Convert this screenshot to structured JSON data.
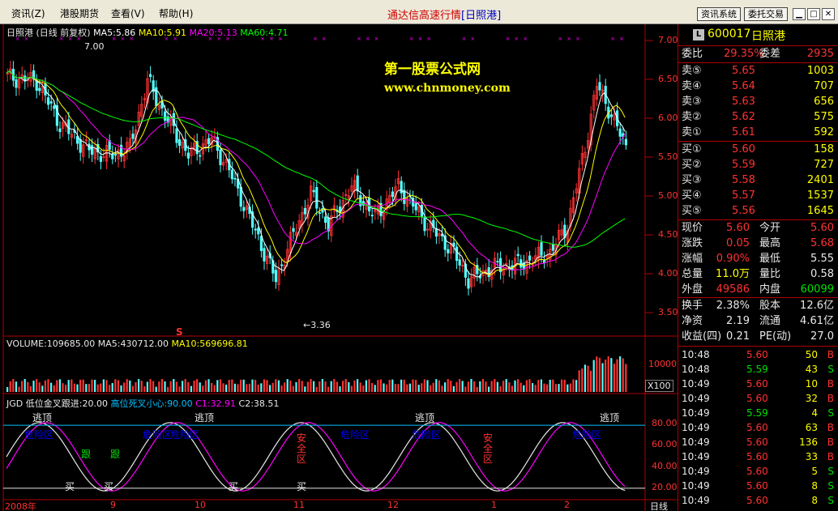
{
  "menu": {
    "items": [
      "资讯(Z)",
      "港股期货",
      "查看(V)",
      "帮助(H)"
    ],
    "title": "通达信高速行情",
    "title_stock": "[日照港]",
    "btn_info": "资讯系统",
    "btn_trade": "委托交易"
  },
  "chart": {
    "header_name": "日照港",
    "header_period": "(日线 前复权)",
    "ma": [
      {
        "label": "MA5:5.86",
        "color": "#ffffff"
      },
      {
        "label": "MA10:5.91",
        "color": "#ffff00"
      },
      {
        "label": "MA20:5.13",
        "color": "#ff00ff"
      },
      {
        "label": "MA60:4.71",
        "color": "#00ff00"
      }
    ],
    "watermark_1": "第一股票公式网",
    "watermark_2": "www.chnmoney.com",
    "high_label": "7.00",
    "low_label": "3.36",
    "s_marker": "S",
    "price_axis": [
      "7.00",
      "6.50",
      "6.00",
      "5.50",
      "5.00",
      "4.50",
      "4.00",
      "3.50"
    ],
    "volume_header": "VOLUME:109685.00",
    "volume_ma5": "MA5:430712.00",
    "volume_ma10": "MA10:569696.81",
    "volume_axis": [
      "10000"
    ],
    "volume_unit": "X100",
    "indicator_header": "JGD",
    "indicator_params": [
      {
        "label": "低位金叉跟进:20.00",
        "color": "#e8e8e8"
      },
      {
        "label": "高位死叉小心:90.00",
        "color": "#00c0ff"
      },
      {
        "label": "C1:32.91",
        "color": "#ff00ff"
      },
      {
        "label": "C2:38.51",
        "color": "#e8e8e8"
      }
    ],
    "indicator_axis": [
      "80.00",
      "60.00",
      "40.00",
      "20.00"
    ],
    "signal_escape": "逃顶",
    "signal_danger": "危险区",
    "signal_buy": "买",
    "signal_safe": "安全区",
    "signal_follow": "跟",
    "date_axis": [
      "2008年",
      "9",
      "10",
      "11",
      "12",
      "1",
      "2"
    ],
    "period_label": "日线",
    "price_scale": [
      3.36,
      7.0
    ]
  },
  "quote": {
    "code": "600017",
    "name": "日照港",
    "badge": "L",
    "ratio": {
      "label1": "委比",
      "value1": "29.35%",
      "label2": "委差",
      "value2": "2935"
    },
    "asks": [
      {
        "label": "卖⑤",
        "price": "5.65",
        "vol": "1003"
      },
      {
        "label": "卖④",
        "price": "5.64",
        "vol": "707"
      },
      {
        "label": "卖③",
        "price": "5.63",
        "vol": "656"
      },
      {
        "label": "卖②",
        "price": "5.62",
        "vol": "575"
      },
      {
        "label": "卖①",
        "price": "5.61",
        "vol": "592"
      }
    ],
    "bids": [
      {
        "label": "买①",
        "price": "5.60",
        "vol": "158"
      },
      {
        "label": "买②",
        "price": "5.59",
        "vol": "727"
      },
      {
        "label": "买③",
        "price": "5.58",
        "vol": "2401"
      },
      {
        "label": "买④",
        "price": "5.57",
        "vol": "1537"
      },
      {
        "label": "买⑤",
        "price": "5.56",
        "vol": "1645"
      }
    ],
    "stats": [
      {
        "l1": "现价",
        "v1": "5.60",
        "c1": "red",
        "l2": "今开",
        "v2": "5.60",
        "c2": "red"
      },
      {
        "l1": "涨跌",
        "v1": "0.05",
        "c1": "red",
        "l2": "最高",
        "v2": "5.68",
        "c2": "red"
      },
      {
        "l1": "涨幅",
        "v1": "0.90%",
        "c1": "red",
        "l2": "最低",
        "v2": "5.55",
        "c2": "white"
      },
      {
        "l1": "总量",
        "v1": "11.0万",
        "c1": "yellow",
        "l2": "量比",
        "v2": "0.58",
        "c2": "white"
      },
      {
        "l1": "外盘",
        "v1": "49586",
        "c1": "red",
        "l2": "内盘",
        "v2": "60099",
        "c2": "green"
      }
    ],
    "stats2": [
      {
        "l1": "换手",
        "v1": "2.38%",
        "l2": "股本",
        "v2": "12.6亿"
      },
      {
        "l1": "净资",
        "v1": "2.19",
        "l2": "流通",
        "v2": "4.61亿"
      },
      {
        "l1": "收益(四)",
        "v1": "0.21",
        "l2": "PE(动)",
        "v2": "27.0"
      }
    ],
    "ticks": [
      {
        "time": "10:48",
        "price": "5.60",
        "vol": "50",
        "dir": "B"
      },
      {
        "time": "10:48",
        "price": "5.59",
        "vol": "43",
        "dir": "S"
      },
      {
        "time": "10:49",
        "price": "5.60",
        "vol": "10",
        "dir": "B"
      },
      {
        "time": "10:49",
        "price": "5.60",
        "vol": "32",
        "dir": "B"
      },
      {
        "time": "10:49",
        "price": "5.59",
        "vol": "4",
        "dir": "S"
      },
      {
        "time": "10:49",
        "price": "5.60",
        "vol": "63",
        "dir": "B"
      },
      {
        "time": "10:49",
        "price": "5.60",
        "vol": "136",
        "dir": "B"
      },
      {
        "time": "10:49",
        "price": "5.60",
        "vol": "33",
        "dir": "B"
      },
      {
        "time": "10:49",
        "price": "5.60",
        "vol": "5",
        "dir": "S"
      },
      {
        "time": "10:49",
        "price": "5.60",
        "vol": "8",
        "dir": "S"
      },
      {
        "time": "10:49",
        "price": "5.60",
        "vol": "8",
        "dir": "S"
      }
    ],
    "colors": {
      "up": "#ff3232",
      "down": "#00e000",
      "neutral": "#e8e8e8",
      "accent": "#ffff00"
    }
  }
}
